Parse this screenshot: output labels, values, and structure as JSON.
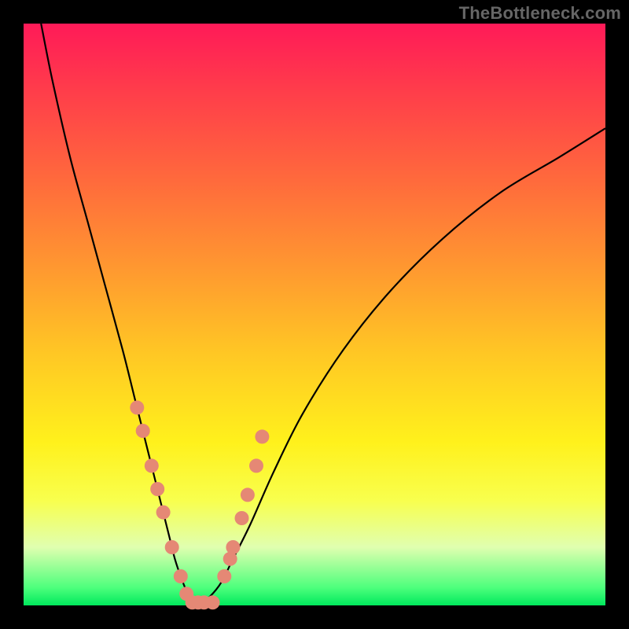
{
  "watermark": "TheBottleneck.com",
  "chart_data": {
    "type": "line",
    "title": "",
    "xlabel": "",
    "ylabel": "",
    "xlim": [
      0,
      100
    ],
    "ylim": [
      0,
      100
    ],
    "series": [
      {
        "name": "left-curve",
        "x": [
          3,
          5,
          8,
          11,
          14,
          17,
          19,
          21,
          23,
          25,
          26,
          27,
          28,
          29,
          30
        ],
        "y": [
          100,
          90,
          77,
          66,
          55,
          44,
          36,
          28,
          20,
          12,
          8,
          5,
          2.5,
          1,
          0
        ]
      },
      {
        "name": "right-curve",
        "x": [
          30,
          32,
          34,
          36,
          39,
          43,
          48,
          55,
          63,
          72,
          82,
          92,
          100
        ],
        "y": [
          0,
          1.5,
          4,
          8,
          14,
          23,
          33,
          44,
          54,
          63,
          71,
          77,
          82
        ]
      }
    ],
    "scatter_points": {
      "name": "markers",
      "x": [
        19.5,
        20.5,
        22,
        23,
        24,
        25.5,
        27,
        28,
        29,
        30,
        31,
        32.5,
        34.5,
        35.5,
        36,
        37.5,
        38.5,
        40,
        41
      ],
      "y": [
        34,
        30,
        24,
        20,
        16,
        10,
        5,
        2,
        0.5,
        0.5,
        0.5,
        0.5,
        5,
        8,
        10,
        15,
        19,
        24,
        29
      ]
    },
    "gradient_bands": [
      {
        "color": "#ff1a58",
        "stop_pct": 0
      },
      {
        "color": "#ff6a3c",
        "stop_pct": 27
      },
      {
        "color": "#ffc824",
        "stop_pct": 57
      },
      {
        "color": "#fff11c",
        "stop_pct": 72
      },
      {
        "color": "#00e85c",
        "stop_pct": 100
      }
    ]
  }
}
